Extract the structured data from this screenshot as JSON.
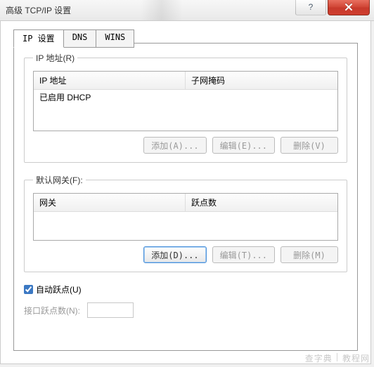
{
  "window": {
    "title": "高级 TCP/IP 设置"
  },
  "tabs": {
    "ip": "IP 设置",
    "dns": "DNS",
    "wins": "WINS"
  },
  "ip_group": {
    "legend": "IP 地址(R)",
    "col_ip": "IP 地址",
    "col_mask": "子网掩码",
    "row0": "已启用 DHCP",
    "add_btn": "添加(A)...",
    "edit_btn": "编辑(E)...",
    "remove_btn": "删除(V)"
  },
  "gateway_group": {
    "legend": "默认网关(F):",
    "col_gateway": "网关",
    "col_metric": "跃点数",
    "add_btn": "添加(D)...",
    "edit_btn": "编辑(T)...",
    "remove_btn": "删除(M)"
  },
  "auto_metric": {
    "checkbox_label": "自动跃点(U)",
    "checked": true,
    "metric_label": "接口跃点数(N):",
    "metric_value": ""
  },
  "watermark": {
    "a": "查字典",
    "b": "教程网"
  }
}
